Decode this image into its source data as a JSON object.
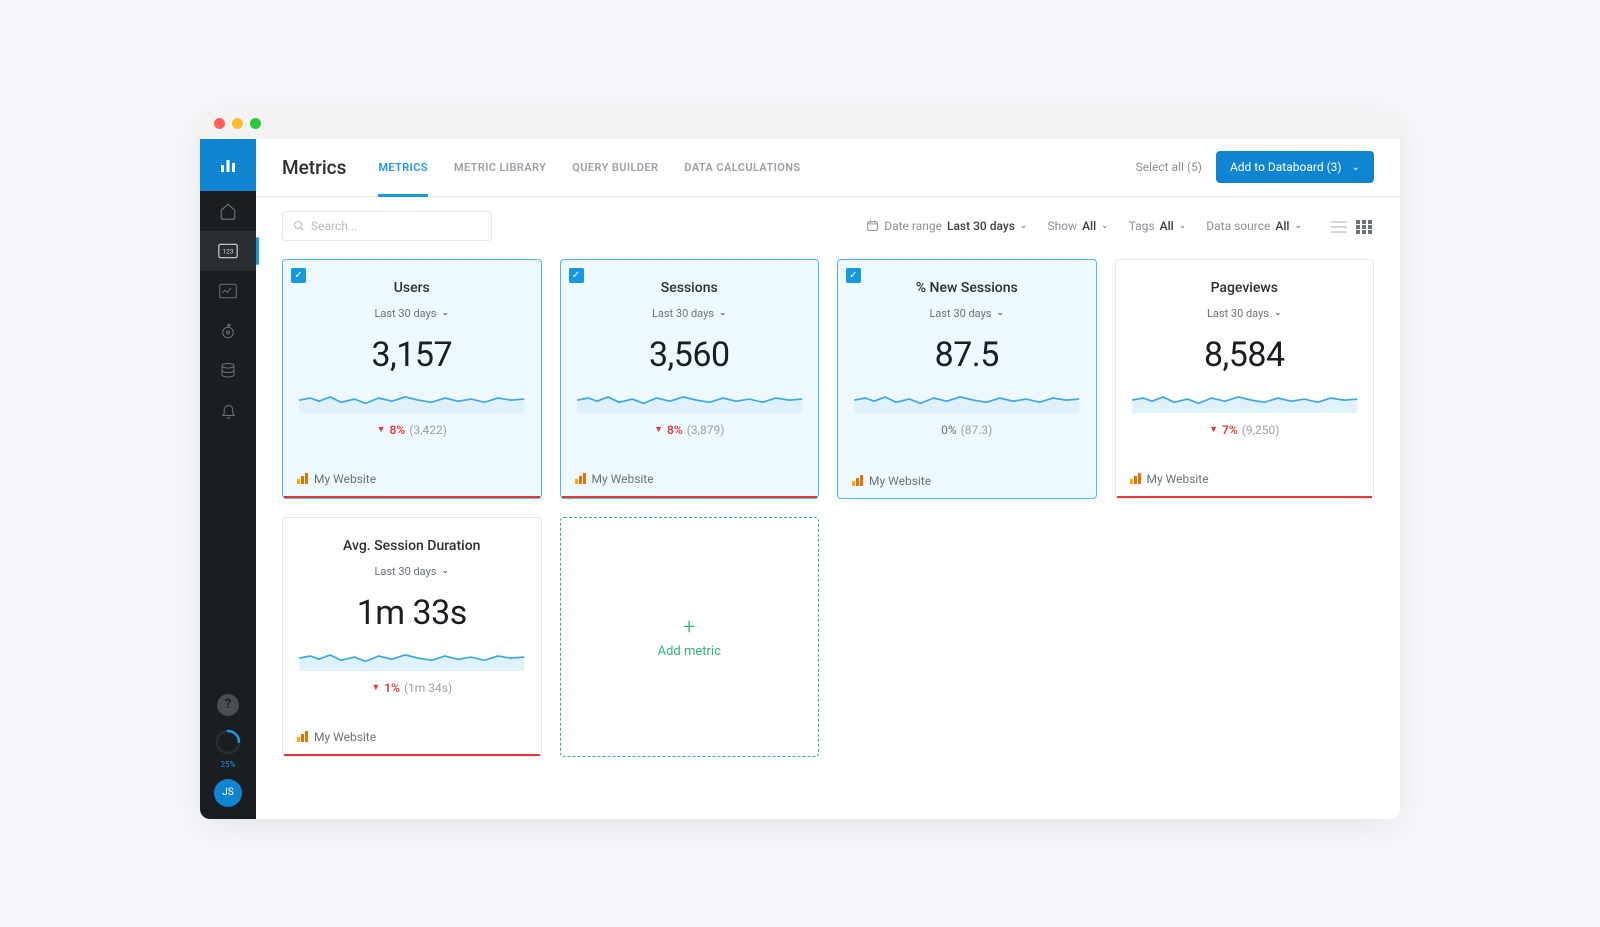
{
  "page_title": "Metrics",
  "tabs": [
    "METRICS",
    "METRIC LIBRARY",
    "QUERY BUILDER",
    "DATA CALCULATIONS"
  ],
  "select_all": "Select all (5)",
  "add_button": "Add to Databoard (3)",
  "search_placeholder": "Search...",
  "filters": {
    "date_range": {
      "label": "Date range",
      "value": "Last 30 days"
    },
    "show": {
      "label": "Show",
      "value": "All"
    },
    "tags": {
      "label": "Tags",
      "value": "All"
    },
    "source": {
      "label": "Data source",
      "value": "All"
    }
  },
  "cards": [
    {
      "title": "Users",
      "period": "Last 30 days",
      "value": "3,157",
      "delta_pct": "8%",
      "delta_dir": "down",
      "prev": "(3,422)",
      "source": "My Website",
      "selected": true,
      "redline": true
    },
    {
      "title": "Sessions",
      "period": "Last 30 days",
      "value": "3,560",
      "delta_pct": "8%",
      "delta_dir": "down",
      "prev": "(3,879)",
      "source": "My Website",
      "selected": true,
      "redline": true
    },
    {
      "title": "% New Sessions",
      "period": "Last 30 days",
      "value": "87.5",
      "delta_pct": "0%",
      "delta_dir": "neutral",
      "prev": "(87.3)",
      "source": "My Website",
      "selected": true,
      "redline": false
    },
    {
      "title": "Pageviews",
      "period": "Last 30 days",
      "value": "8,584",
      "delta_pct": "7%",
      "delta_dir": "down",
      "prev": "(9,250)",
      "source": "My Website",
      "selected": false,
      "redline": true
    },
    {
      "title": "Avg. Session Duration",
      "period": "Last 30 days",
      "value": "1m 33s",
      "delta_pct": "1%",
      "delta_dir": "down",
      "prev": "(1m 34s)",
      "source": "My Website",
      "selected": false,
      "redline": true
    }
  ],
  "add_metric_label": "Add metric",
  "progress_label": "25%",
  "avatar": "JS"
}
